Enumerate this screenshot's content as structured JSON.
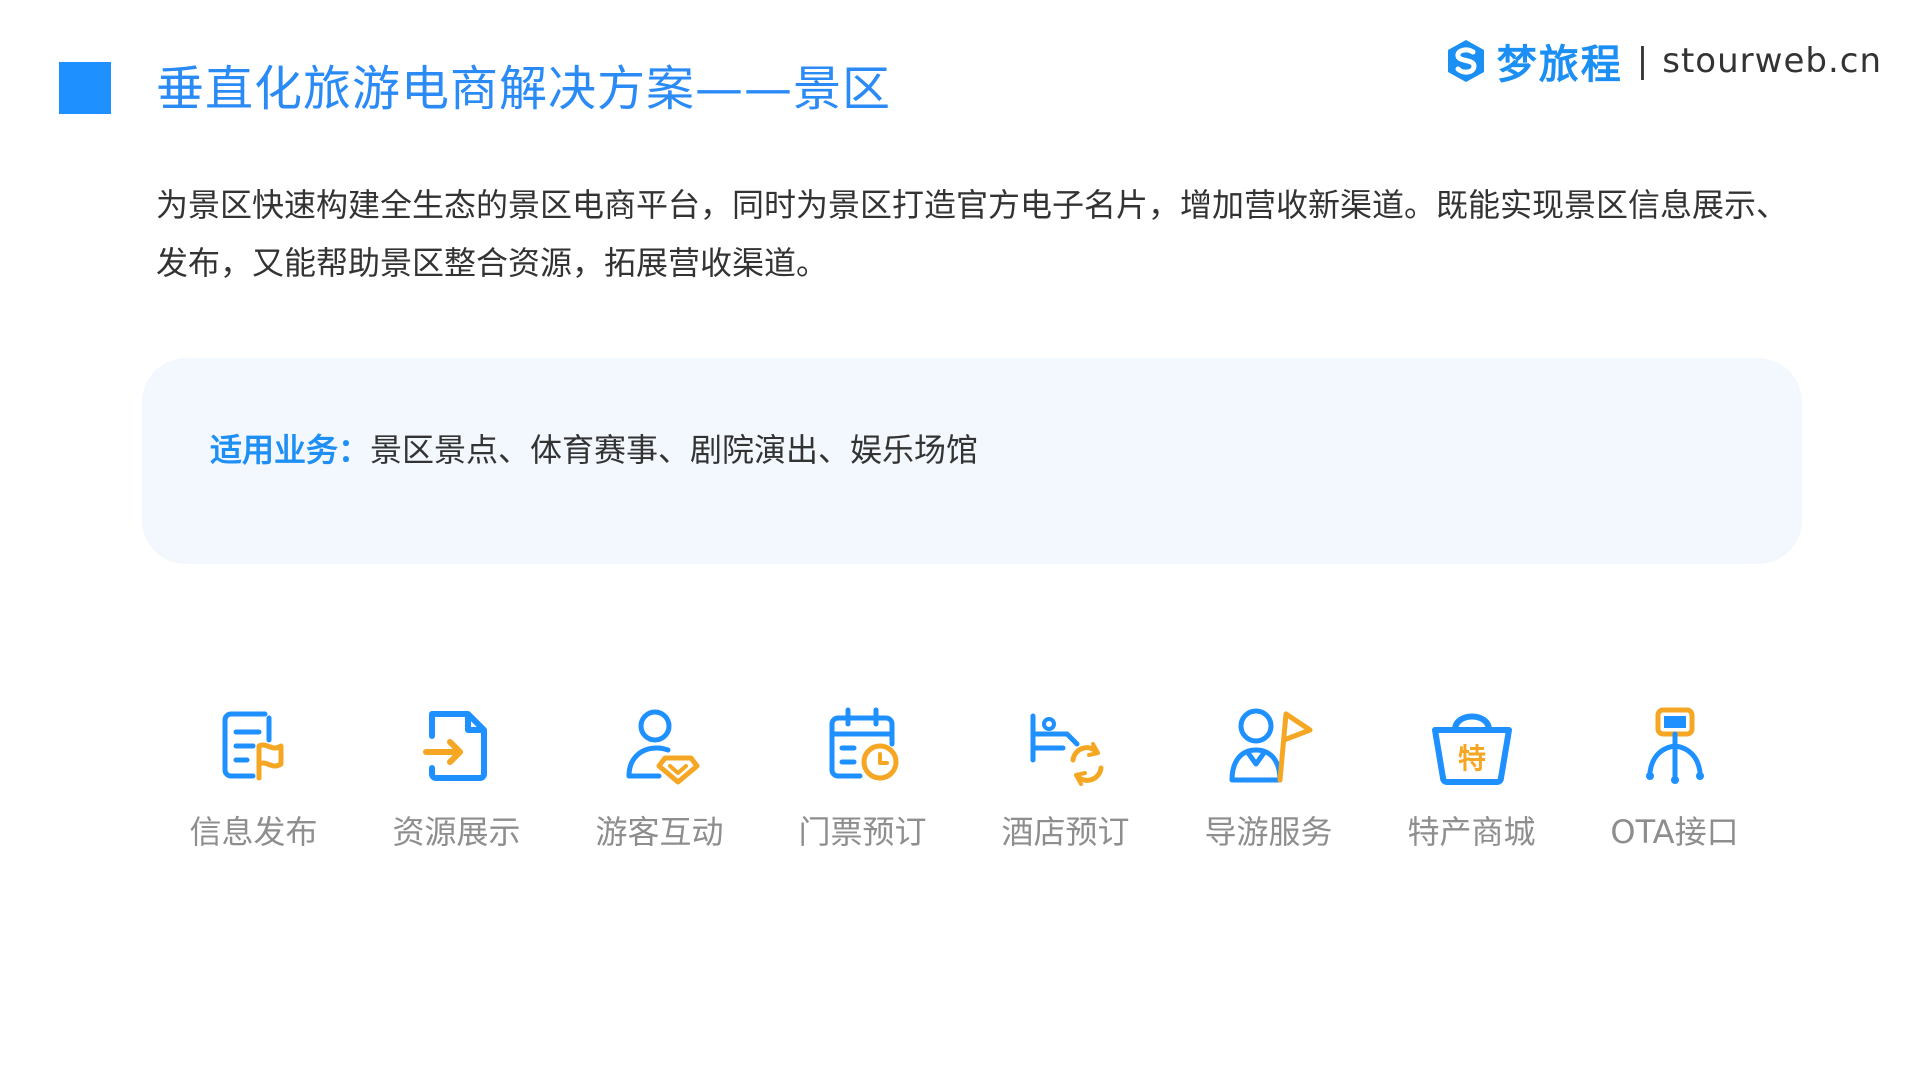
{
  "header": {
    "title": "垂直化旅游电商解决方案——景区",
    "brand_name": "梦旅程",
    "brand_separator": "|",
    "brand_site": "stourweb.cn"
  },
  "intro": {
    "text": "为景区快速构建全生态的景区电商平台，同时为景区打造官方电子名片，增加营收新渠道。既能实现景区信息展示、发布，又能帮助景区整合资源，拓展营收渠道。"
  },
  "business": {
    "label": "适用业务：",
    "text": "景区景点、体育赛事、剧院演出、娱乐场馆"
  },
  "features": [
    {
      "label": "信息发布",
      "icon": "document-flag-icon"
    },
    {
      "label": "资源展示",
      "icon": "file-arrow-icon"
    },
    {
      "label": "游客互动",
      "icon": "user-diamond-icon"
    },
    {
      "label": "门票预订",
      "icon": "calendar-clock-icon"
    },
    {
      "label": "酒店预订",
      "icon": "bed-refresh-icon"
    },
    {
      "label": "导游服务",
      "icon": "guide-flag-icon"
    },
    {
      "label": "特产商城",
      "icon": "shopping-basket-icon"
    },
    {
      "label": "OTA接口",
      "icon": "network-node-icon"
    }
  ],
  "colors": {
    "primary": "#1e90ff",
    "accent": "#f5a623",
    "title": "#2a8af6",
    "text": "#333333",
    "muted": "#8e8e8e",
    "card": "#f3f8fe"
  }
}
